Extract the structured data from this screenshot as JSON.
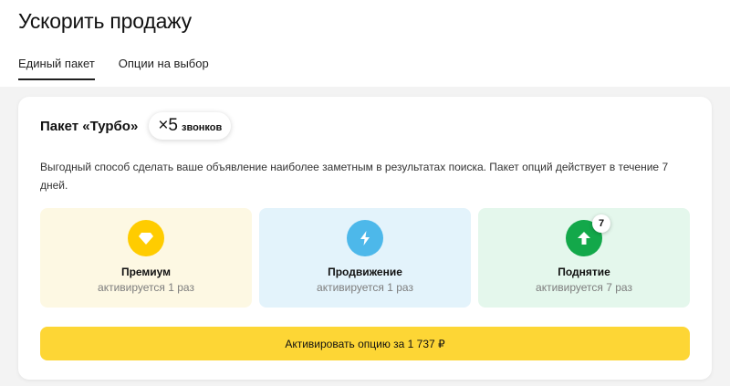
{
  "page": {
    "title": "Ускорить продажу"
  },
  "tabs": [
    {
      "label": "Единый пакет",
      "active": true
    },
    {
      "label": "Опции на выбор",
      "active": false
    }
  ],
  "package": {
    "title": "Пакет «Турбо»",
    "calls_multiplier": "×5",
    "calls_unit": "звонков",
    "description": "Выгодный способ сделать ваше объявление наиболее заметным в результатах поиска. Пакет опций действует в течение 7 дней.",
    "options": [
      {
        "icon": "diamond-icon",
        "color": "#ffcc00",
        "name": "Премиум",
        "subtitle": "активируется 1 раз"
      },
      {
        "icon": "lightning-icon",
        "color": "#4db8ea",
        "name": "Продвижение",
        "subtitle": "активируется 1 раз"
      },
      {
        "icon": "arrow-up-icon",
        "color": "#13a84a",
        "name": "Поднятие",
        "subtitle": "активируется 7 раз",
        "badge": "7"
      }
    ],
    "cta_label": "Активировать опцию за 1 737 ₽"
  },
  "colors": {
    "accent": "#fdd635"
  }
}
